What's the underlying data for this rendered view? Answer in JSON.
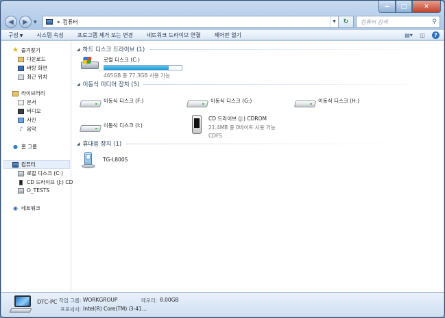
{
  "address": {
    "path": "컴퓨터",
    "search_placeholder": "컴퓨터 검색"
  },
  "toolbar": {
    "organize": "구성",
    "system_properties": "시스템 속성",
    "uninstall": "프로그램 제거 또는 변경",
    "map_drive": "네트워크 드라이브 연결",
    "control_panel": "제어판 열기"
  },
  "sidebar": {
    "favorites": "즐겨찾기",
    "downloads": "다운로드",
    "desktop": "바탕 화면",
    "recent": "최근 위치",
    "libraries": "라이브러리",
    "documents": "문서",
    "videos": "비디오",
    "pictures": "사진",
    "music": "음악",
    "homegroup": "홈 그룹",
    "computer": "컴퓨터",
    "local_disk": "로컬 디스크 (C:)",
    "cd_drive": "CD 드라이브 (J:) CD",
    "o_tests": "O_TESTS",
    "network": "네트워크"
  },
  "groups": {
    "hdd": "하드 디스크 드라이브 (1)",
    "removable": "이동식 미디어 장치 (5)",
    "portable": "휴대용 장치 (1)"
  },
  "drives": {
    "c_name": "로컬 디스크 (C:)",
    "c_usage": "465GB 중 77.3GB 사용 가능",
    "c_used_fraction": 0.834,
    "f": "이동식 디스크 (F:)",
    "g": "이동식 디스크 (G:)",
    "h": "이동식 디스크 (H:)",
    "i": "이동식 디스크 (I:)",
    "j_name": "CD 드라이브 (J:) CDROM",
    "j_usage": "21.4MB 중 0바이트 사용 가능",
    "j_fs": "CDFS",
    "device": "TG-L800S"
  },
  "details": {
    "pc_name": "DTC-PC",
    "workgroup_label": "작업 그룹:",
    "workgroup_value": "WORKGROUP",
    "memory_label": "메모리:",
    "memory_value": "8.00GB",
    "processor_label": "프로세서:",
    "processor_value": "Intel(R) Core(TM) i3-41..."
  }
}
